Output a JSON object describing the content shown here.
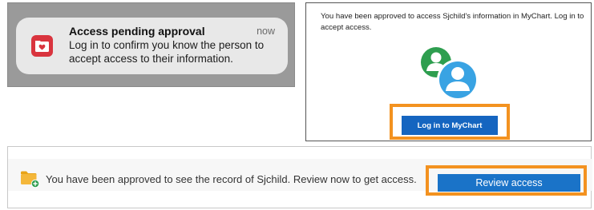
{
  "notification": {
    "icon": "heart-folder-icon",
    "title": "Access pending approval",
    "time": "now",
    "body": "Log in to confirm you know the person to accept access to their information.",
    "icon_color": "#d9343e"
  },
  "email": {
    "message": "You have been approved to access Sjchild's information in MyChart. Log in to accept access.",
    "avatars": [
      "green-person-icon",
      "blue-person-icon"
    ],
    "login_button_label": "Log in to MyChart",
    "button_color": "#1565c0"
  },
  "banner": {
    "icon": "folder-plus-icon",
    "message": "You have been approved to see the record of Sjchild. Review now to get access.",
    "review_button_label": "Review access",
    "button_color": "#1a73c8"
  },
  "highlight_color": "#f39220"
}
